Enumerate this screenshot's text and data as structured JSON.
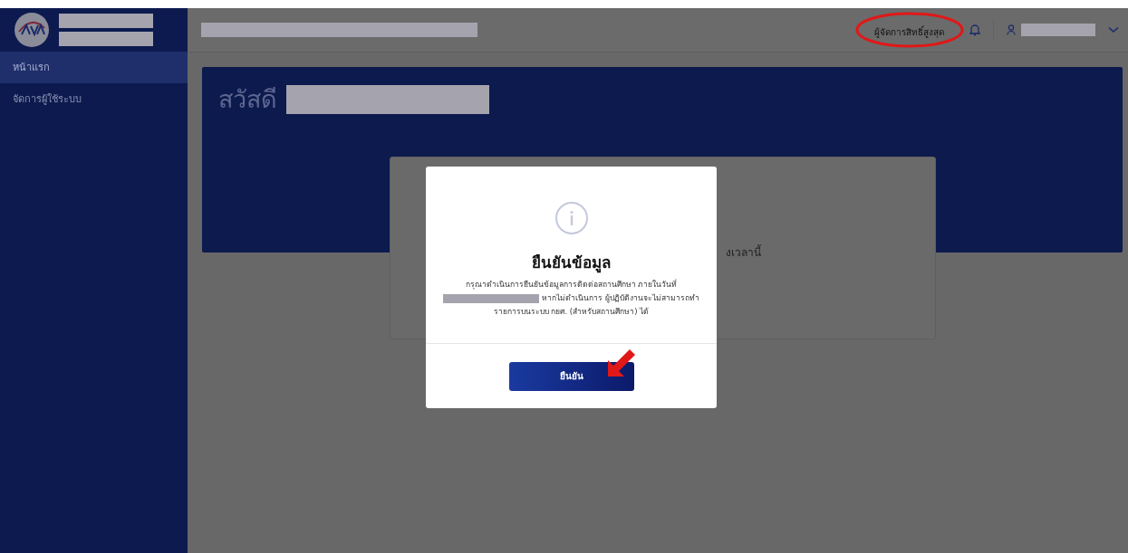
{
  "sidebar": {
    "items": [
      {
        "label": "หน้าแรก",
        "selected": true
      },
      {
        "label": "จัดการผู้ใช้ระบบ",
        "selected": false
      }
    ]
  },
  "topbar": {
    "role": "ผู้จัดการสิทธิ์สูงสุด"
  },
  "welcome": {
    "greeting": "สวัสดี"
  },
  "background_card": {
    "text_fragment": "งเวลานี้"
  },
  "dialog": {
    "title": "ยืนยันข้อมูล",
    "message_before": "กรุณาดำเนินการยืนยันข้อมูลการติดต่อสถานศึกษา ภายในวันที่",
    "message_after": "หากไม่ดำเนินการ ผู้ปฏิบัติงานจะไม่สามารถทำรายการบนระบบ กยศ. (สำหรับสถานศึกษา) ได้",
    "confirm_button": "ยืนยัน"
  }
}
